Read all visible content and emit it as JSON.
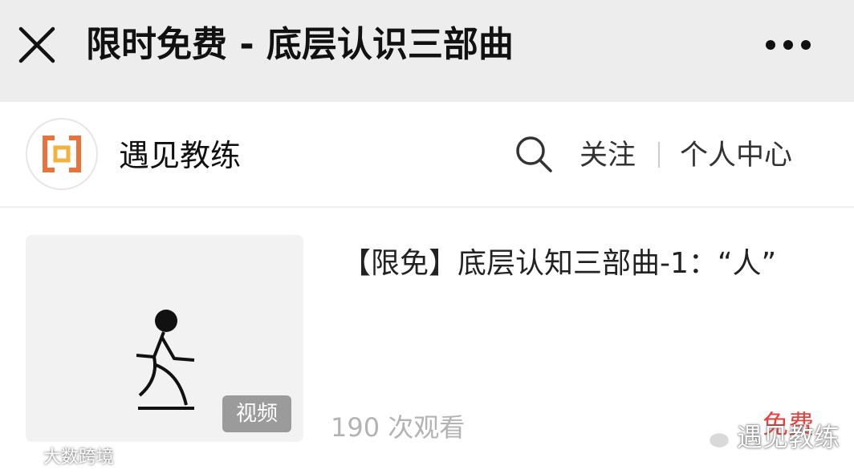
{
  "topbar": {
    "title": "限时免费 - 底层认识三部曲"
  },
  "account": {
    "name": "遇见教练",
    "follow_label": "关注",
    "center_label": "个人中心"
  },
  "item": {
    "title": "【限免】底层认知三部曲-1：“人”",
    "badge": "视频",
    "views": "190 次观看",
    "price": "免费"
  },
  "watermarks": {
    "right": "遇见教练",
    "left": "大数跨境"
  },
  "colors": {
    "topbar_bg": "#ededed",
    "price": "#e64340",
    "logo_orange": "#e8743a",
    "logo_yellow": "#f2b33d"
  },
  "icons": {
    "close": "close-icon",
    "more": "more-dots-icon",
    "search": "search-icon",
    "logo": "brand-logo-icon",
    "wechat": "wechat-icon"
  }
}
